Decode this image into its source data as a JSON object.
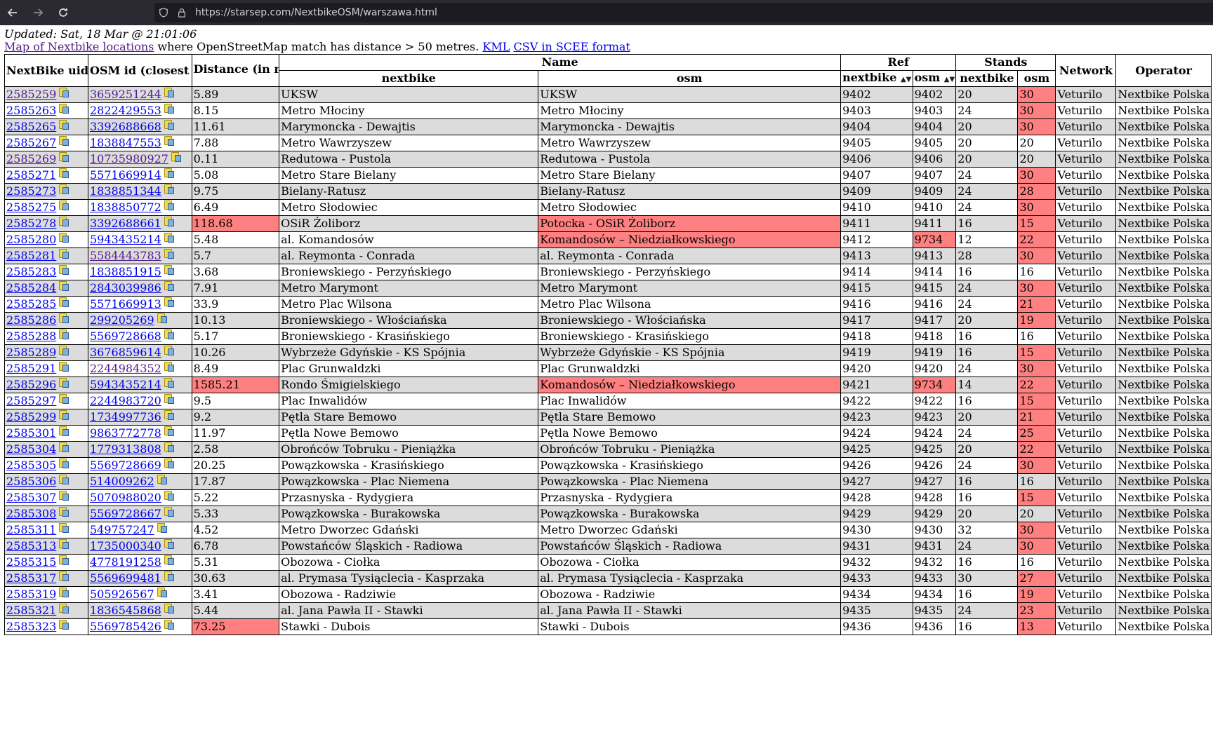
{
  "browser": {
    "url": "https://starsep.com/NextbikeOSM/warszawa.html"
  },
  "page": {
    "updated": "Updated: Sat, 18 Mar @ 21:01:06",
    "map_link": "Map of Nextbike locations",
    "desc_text": " where OpenStreetMap match has distance > 50 metres. ",
    "kml_link": "KML",
    "csv_link": "CSV in SCEE format"
  },
  "table": {
    "headers": {
      "uid": "NextBike uid",
      "osm_id": "OSM id (closest match)",
      "distance": "Distance (in meters)",
      "name": "Name",
      "ref": "Ref",
      "stands": "Stands",
      "network": "Network",
      "operator": "Operator",
      "name_nextbike": "nextbike",
      "name_osm": "osm",
      "ref_nextbike": "nextbike",
      "ref_osm": "osm",
      "stands_nextbike": "nextbike",
      "stands_osm": "osm"
    },
    "rows": [
      {
        "uid": "2585259",
        "uid_visited": true,
        "osm": "3659251244",
        "osm_visited": true,
        "dist": "5.89",
        "dist_red": false,
        "name_nb": "UKSW",
        "name_osm": "UKSW",
        "name_red": false,
        "ref_nb": "9402",
        "ref_osm": "9402",
        "ref_red": false,
        "st_nb": "20",
        "st_osm": "30",
        "st_red": true,
        "network": "Veturilo",
        "operator": "Nextbike Polska"
      },
      {
        "uid": "2585263",
        "uid_visited": false,
        "osm": "2822429553",
        "osm_visited": false,
        "dist": "8.15",
        "dist_red": false,
        "name_nb": "Metro Młociny",
        "name_osm": "Metro Młociny",
        "name_red": false,
        "ref_nb": "9403",
        "ref_osm": "9403",
        "ref_red": false,
        "st_nb": "24",
        "st_osm": "30",
        "st_red": true,
        "network": "Veturilo",
        "operator": "Nextbike Polska"
      },
      {
        "uid": "2585265",
        "uid_visited": false,
        "osm": "3392688668",
        "osm_visited": false,
        "dist": "11.61",
        "dist_red": false,
        "name_nb": "Marymoncka - Dewajtis",
        "name_osm": "Marymoncka - Dewajtis",
        "name_red": false,
        "ref_nb": "9404",
        "ref_osm": "9404",
        "ref_red": false,
        "st_nb": "20",
        "st_osm": "30",
        "st_red": true,
        "network": "Veturilo",
        "operator": "Nextbike Polska"
      },
      {
        "uid": "2585267",
        "uid_visited": false,
        "osm": "1838847553",
        "osm_visited": false,
        "dist": "7.88",
        "dist_red": false,
        "name_nb": "Metro Wawrzyszew",
        "name_osm": "Metro Wawrzyszew",
        "name_red": false,
        "ref_nb": "9405",
        "ref_osm": "9405",
        "ref_red": false,
        "st_nb": "20",
        "st_osm": "20",
        "st_red": false,
        "network": "Veturilo",
        "operator": "Nextbike Polska"
      },
      {
        "uid": "2585269",
        "uid_visited": true,
        "osm": "10735980927",
        "osm_visited": true,
        "dist": "0.11",
        "dist_red": false,
        "name_nb": "Redutowa - Pustola",
        "name_osm": "Redutowa - Pustola",
        "name_red": false,
        "ref_nb": "9406",
        "ref_osm": "9406",
        "ref_red": false,
        "st_nb": "20",
        "st_osm": "20",
        "st_red": false,
        "network": "Veturilo",
        "operator": "Nextbike Polska"
      },
      {
        "uid": "2585271",
        "uid_visited": false,
        "osm": "5571669914",
        "osm_visited": false,
        "dist": "5.08",
        "dist_red": false,
        "name_nb": "Metro Stare Bielany",
        "name_osm": "Metro Stare Bielany",
        "name_red": false,
        "ref_nb": "9407",
        "ref_osm": "9407",
        "ref_red": false,
        "st_nb": "24",
        "st_osm": "30",
        "st_red": true,
        "network": "Veturilo",
        "operator": "Nextbike Polska"
      },
      {
        "uid": "2585273",
        "uid_visited": false,
        "osm": "1838851344",
        "osm_visited": false,
        "dist": "9.75",
        "dist_red": false,
        "name_nb": "Bielany-Ratusz",
        "name_osm": "Bielany-Ratusz",
        "name_red": false,
        "ref_nb": "9409",
        "ref_osm": "9409",
        "ref_red": false,
        "st_nb": "24",
        "st_osm": "28",
        "st_red": true,
        "network": "Veturilo",
        "operator": "Nextbike Polska"
      },
      {
        "uid": "2585275",
        "uid_visited": false,
        "osm": "1838850772",
        "osm_visited": false,
        "dist": "6.49",
        "dist_red": false,
        "name_nb": "Metro Słodowiec",
        "name_osm": "Metro Słodowiec",
        "name_red": false,
        "ref_nb": "9410",
        "ref_osm": "9410",
        "ref_red": false,
        "st_nb": "24",
        "st_osm": "30",
        "st_red": true,
        "network": "Veturilo",
        "operator": "Nextbike Polska"
      },
      {
        "uid": "2585278",
        "uid_visited": false,
        "osm": "3392688661",
        "osm_visited": false,
        "dist": "118.68",
        "dist_red": true,
        "name_nb": "OSiR Żoliborz",
        "name_osm": "Potocka - OSiR Żoliborz",
        "name_red": true,
        "ref_nb": "9411",
        "ref_osm": "9411",
        "ref_red": false,
        "st_nb": "16",
        "st_osm": "15",
        "st_red": true,
        "network": "Veturilo",
        "operator": "Nextbike Polska"
      },
      {
        "uid": "2585280",
        "uid_visited": false,
        "osm": "5943435214",
        "osm_visited": false,
        "dist": "5.48",
        "dist_red": false,
        "name_nb": "al. Komandosów",
        "name_osm": "Komandosów – Niedziałkowskiego",
        "name_red": true,
        "ref_nb": "9412",
        "ref_osm": "9734",
        "ref_red": true,
        "st_nb": "12",
        "st_osm": "22",
        "st_red": true,
        "network": "Veturilo",
        "operator": "Nextbike Polska"
      },
      {
        "uid": "2585281",
        "uid_visited": false,
        "osm": "5584443783",
        "osm_visited": true,
        "dist": "5.7",
        "dist_red": false,
        "name_nb": "al. Reymonta - Conrada",
        "name_osm": "al. Reymonta - Conrada",
        "name_red": false,
        "ref_nb": "9413",
        "ref_osm": "9413",
        "ref_red": false,
        "st_nb": "28",
        "st_osm": "30",
        "st_red": true,
        "network": "Veturilo",
        "operator": "Nextbike Polska"
      },
      {
        "uid": "2585283",
        "uid_visited": false,
        "osm": "1838851915",
        "osm_visited": false,
        "dist": "3.68",
        "dist_red": false,
        "name_nb": "Broniewskiego - Perzyńskiego",
        "name_osm": "Broniewskiego - Perzyńskiego",
        "name_red": false,
        "ref_nb": "9414",
        "ref_osm": "9414",
        "ref_red": false,
        "st_nb": "16",
        "st_osm": "16",
        "st_red": false,
        "network": "Veturilo",
        "operator": "Nextbike Polska"
      },
      {
        "uid": "2585284",
        "uid_visited": false,
        "osm": "2843039986",
        "osm_visited": false,
        "dist": "7.91",
        "dist_red": false,
        "name_nb": "Metro Marymont",
        "name_osm": "Metro Marymont",
        "name_red": false,
        "ref_nb": "9415",
        "ref_osm": "9415",
        "ref_red": false,
        "st_nb": "24",
        "st_osm": "30",
        "st_red": true,
        "network": "Veturilo",
        "operator": "Nextbike Polska"
      },
      {
        "uid": "2585285",
        "uid_visited": false,
        "osm": "5571669913",
        "osm_visited": false,
        "dist": "33.9",
        "dist_red": false,
        "name_nb": "Metro Plac Wilsona",
        "name_osm": "Metro Plac Wilsona",
        "name_red": false,
        "ref_nb": "9416",
        "ref_osm": "9416",
        "ref_red": false,
        "st_nb": "24",
        "st_osm": "21",
        "st_red": true,
        "network": "Veturilo",
        "operator": "Nextbike Polska"
      },
      {
        "uid": "2585286",
        "uid_visited": false,
        "osm": "299205269",
        "osm_visited": false,
        "dist": "10.13",
        "dist_red": false,
        "name_nb": "Broniewskiego - Włościańska",
        "name_osm": "Broniewskiego - Włościańska",
        "name_red": false,
        "ref_nb": "9417",
        "ref_osm": "9417",
        "ref_red": false,
        "st_nb": "20",
        "st_osm": "19",
        "st_red": true,
        "network": "Veturilo",
        "operator": "Nextbike Polska"
      },
      {
        "uid": "2585288",
        "uid_visited": false,
        "osm": "5569728668",
        "osm_visited": false,
        "dist": "5.17",
        "dist_red": false,
        "name_nb": "Broniewskiego - Krasińskiego",
        "name_osm": "Broniewskiego - Krasińskiego",
        "name_red": false,
        "ref_nb": "9418",
        "ref_osm": "9418",
        "ref_red": false,
        "st_nb": "16",
        "st_osm": "16",
        "st_red": false,
        "network": "Veturilo",
        "operator": "Nextbike Polska"
      },
      {
        "uid": "2585289",
        "uid_visited": false,
        "osm": "3676859614",
        "osm_visited": false,
        "dist": "10.26",
        "dist_red": false,
        "name_nb": "Wybrzeże Gdyńskie - KS Spójnia",
        "name_osm": "Wybrzeże Gdyńskie - KS Spójnia",
        "name_red": false,
        "ref_nb": "9419",
        "ref_osm": "9419",
        "ref_red": false,
        "st_nb": "16",
        "st_osm": "15",
        "st_red": true,
        "network": "Veturilo",
        "operator": "Nextbike Polska"
      },
      {
        "uid": "2585291",
        "uid_visited": false,
        "osm": "2244984352",
        "osm_visited": true,
        "dist": "8.49",
        "dist_red": false,
        "name_nb": "Plac Grunwaldzki",
        "name_osm": "Plac Grunwaldzki",
        "name_red": false,
        "ref_nb": "9420",
        "ref_osm": "9420",
        "ref_red": false,
        "st_nb": "24",
        "st_osm": "30",
        "st_red": true,
        "network": "Veturilo",
        "operator": "Nextbike Polska"
      },
      {
        "uid": "2585296",
        "uid_visited": false,
        "osm": "5943435214",
        "osm_visited": false,
        "dist": "1585.21",
        "dist_red": true,
        "name_nb": "Rondo Śmigielskiego",
        "name_osm": "Komandosów – Niedziałkowskiego",
        "name_red": true,
        "ref_nb": "9421",
        "ref_osm": "9734",
        "ref_red": true,
        "st_nb": "14",
        "st_osm": "22",
        "st_red": true,
        "network": "Veturilo",
        "operator": "Nextbike Polska"
      },
      {
        "uid": "2585297",
        "uid_visited": false,
        "osm": "2244983720",
        "osm_visited": false,
        "dist": "9.5",
        "dist_red": false,
        "name_nb": "Plac Inwalidów",
        "name_osm": "Plac Inwalidów",
        "name_red": false,
        "ref_nb": "9422",
        "ref_osm": "9422",
        "ref_red": false,
        "st_nb": "16",
        "st_osm": "15",
        "st_red": true,
        "network": "Veturilo",
        "operator": "Nextbike Polska"
      },
      {
        "uid": "2585299",
        "uid_visited": false,
        "osm": "1734997736",
        "osm_visited": false,
        "dist": "9.2",
        "dist_red": false,
        "name_nb": "Pętla Stare Bemowo",
        "name_osm": "Pętla Stare Bemowo",
        "name_red": false,
        "ref_nb": "9423",
        "ref_osm": "9423",
        "ref_red": false,
        "st_nb": "20",
        "st_osm": "21",
        "st_red": true,
        "network": "Veturilo",
        "operator": "Nextbike Polska"
      },
      {
        "uid": "2585301",
        "uid_visited": false,
        "osm": "9863772778",
        "osm_visited": false,
        "dist": "11.97",
        "dist_red": false,
        "name_nb": "Pętla Nowe Bemowo",
        "name_osm": "Pętla Nowe Bemowo",
        "name_red": false,
        "ref_nb": "9424",
        "ref_osm": "9424",
        "ref_red": false,
        "st_nb": "24",
        "st_osm": "25",
        "st_red": true,
        "network": "Veturilo",
        "operator": "Nextbike Polska"
      },
      {
        "uid": "2585304",
        "uid_visited": false,
        "osm": "1779313808",
        "osm_visited": false,
        "dist": "2.58",
        "dist_red": false,
        "name_nb": "Obrońców Tobruku - Pieniążka",
        "name_osm": "Obrońców Tobruku - Pieniążka",
        "name_red": false,
        "ref_nb": "9425",
        "ref_osm": "9425",
        "ref_red": false,
        "st_nb": "20",
        "st_osm": "22",
        "st_red": true,
        "network": "Veturilo",
        "operator": "Nextbike Polska"
      },
      {
        "uid": "2585305",
        "uid_visited": false,
        "osm": "5569728669",
        "osm_visited": false,
        "dist": "20.25",
        "dist_red": false,
        "name_nb": "Powązkowska - Krasińskiego",
        "name_osm": "Powązkowska - Krasińskiego",
        "name_red": false,
        "ref_nb": "9426",
        "ref_osm": "9426",
        "ref_red": false,
        "st_nb": "24",
        "st_osm": "30",
        "st_red": true,
        "network": "Veturilo",
        "operator": "Nextbike Polska"
      },
      {
        "uid": "2585306",
        "uid_visited": false,
        "osm": "514009262",
        "osm_visited": false,
        "dist": "17.87",
        "dist_red": false,
        "name_nb": "Powązkowska - Plac Niemena",
        "name_osm": "Powązkowska - Plac Niemena",
        "name_red": false,
        "ref_nb": "9427",
        "ref_osm": "9427",
        "ref_red": false,
        "st_nb": "16",
        "st_osm": "16",
        "st_red": false,
        "network": "Veturilo",
        "operator": "Nextbike Polska"
      },
      {
        "uid": "2585307",
        "uid_visited": false,
        "osm": "5070988020",
        "osm_visited": false,
        "dist": "5.22",
        "dist_red": false,
        "name_nb": "Przasnyska - Rydygiera",
        "name_osm": "Przasnyska - Rydygiera",
        "name_red": false,
        "ref_nb": "9428",
        "ref_osm": "9428",
        "ref_red": false,
        "st_nb": "16",
        "st_osm": "15",
        "st_red": true,
        "network": "Veturilo",
        "operator": "Nextbike Polska"
      },
      {
        "uid": "2585308",
        "uid_visited": false,
        "osm": "5569728667",
        "osm_visited": false,
        "dist": "5.33",
        "dist_red": false,
        "name_nb": "Powązkowska - Burakowska",
        "name_osm": "Powązkowska - Burakowska",
        "name_red": false,
        "ref_nb": "9429",
        "ref_osm": "9429",
        "ref_red": false,
        "st_nb": "20",
        "st_osm": "20",
        "st_red": false,
        "network": "Veturilo",
        "operator": "Nextbike Polska"
      },
      {
        "uid": "2585311",
        "uid_visited": false,
        "osm": "549757247",
        "osm_visited": false,
        "dist": "4.52",
        "dist_red": false,
        "name_nb": "Metro Dworzec Gdański",
        "name_osm": "Metro Dworzec Gdański",
        "name_red": false,
        "ref_nb": "9430",
        "ref_osm": "9430",
        "ref_red": false,
        "st_nb": "32",
        "st_osm": "30",
        "st_red": true,
        "network": "Veturilo",
        "operator": "Nextbike Polska"
      },
      {
        "uid": "2585313",
        "uid_visited": false,
        "osm": "1735000340",
        "osm_visited": false,
        "dist": "6.78",
        "dist_red": false,
        "name_nb": "Powstańców Śląskich - Radiowa",
        "name_osm": "Powstańców Śląskich - Radiowa",
        "name_red": false,
        "ref_nb": "9431",
        "ref_osm": "9431",
        "ref_red": false,
        "st_nb": "24",
        "st_osm": "30",
        "st_red": true,
        "network": "Veturilo",
        "operator": "Nextbike Polska"
      },
      {
        "uid": "2585315",
        "uid_visited": false,
        "osm": "4778191258",
        "osm_visited": false,
        "dist": "5.31",
        "dist_red": false,
        "name_nb": "Obozowa - Ciołka",
        "name_osm": "Obozowa - Ciołka",
        "name_red": false,
        "ref_nb": "9432",
        "ref_osm": "9432",
        "ref_red": false,
        "st_nb": "16",
        "st_osm": "16",
        "st_red": false,
        "network": "Veturilo",
        "operator": "Nextbike Polska"
      },
      {
        "uid": "2585317",
        "uid_visited": false,
        "osm": "5569699481",
        "osm_visited": false,
        "dist": "30.63",
        "dist_red": false,
        "name_nb": "al. Prymasa Tysiąclecia - Kasprzaka",
        "name_osm": "al. Prymasa Tysiąclecia - Kasprzaka",
        "name_red": false,
        "ref_nb": "9433",
        "ref_osm": "9433",
        "ref_red": false,
        "st_nb": "30",
        "st_osm": "27",
        "st_red": true,
        "network": "Veturilo",
        "operator": "Nextbike Polska"
      },
      {
        "uid": "2585319",
        "uid_visited": false,
        "osm": "505926567",
        "osm_visited": false,
        "dist": "3.41",
        "dist_red": false,
        "name_nb": "Obozowa - Radziwie",
        "name_osm": "Obozowa - Radziwie",
        "name_red": false,
        "ref_nb": "9434",
        "ref_osm": "9434",
        "ref_red": false,
        "st_nb": "16",
        "st_osm": "19",
        "st_red": true,
        "network": "Veturilo",
        "operator": "Nextbike Polska"
      },
      {
        "uid": "2585321",
        "uid_visited": false,
        "osm": "1836545868",
        "osm_visited": false,
        "dist": "5.44",
        "dist_red": false,
        "name_nb": "al. Jana Pawła II - Stawki",
        "name_osm": "al. Jana Pawła II - Stawki",
        "name_red": false,
        "ref_nb": "9435",
        "ref_osm": "9435",
        "ref_red": false,
        "st_nb": "24",
        "st_osm": "23",
        "st_red": true,
        "network": "Veturilo",
        "operator": "Nextbike Polska"
      },
      {
        "uid": "2585323",
        "uid_visited": false,
        "osm": "5569785426",
        "osm_visited": false,
        "dist": "73.25",
        "dist_red": true,
        "name_nb": "Stawki - Dubois",
        "name_osm": "Stawki - Dubois",
        "name_red": false,
        "ref_nb": "9436",
        "ref_osm": "9436",
        "ref_red": false,
        "st_nb": "16",
        "st_osm": "13",
        "st_red": true,
        "network": "Veturilo",
        "operator": "Nextbike Polska"
      }
    ]
  }
}
